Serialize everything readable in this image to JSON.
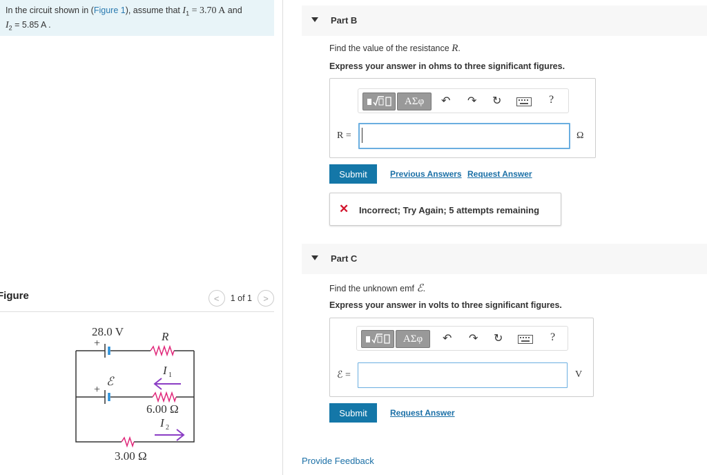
{
  "problem": {
    "text_a": "In the circuit shown in (",
    "link": "Figure 1",
    "text_b": "), assume that ",
    "i1_var": "I",
    "i1_sub": "1",
    "i1_val": " = 3.70 A",
    "and": " and",
    "i2_var": "I",
    "i2_sub": "2",
    "i2_val": " = 5.85 A",
    "end": " ."
  },
  "figure": {
    "title": "Figure",
    "pager_text": "1 of 1",
    "prev": "<",
    "next": ">"
  },
  "circuit": {
    "emf1_label": "28.0 V",
    "r_label": "R",
    "i1_label": "I",
    "i1_sub": "1",
    "emf_label": "ℰ",
    "r6_label": "6.00 Ω",
    "i2_label": "I",
    "i2_sub": "2",
    "r3_label": "3.00 Ω",
    "plus1": "+",
    "plus2": "+"
  },
  "toolbar": {
    "greek": "ΑΣφ",
    "help": "?"
  },
  "part_b": {
    "title": "Part B",
    "question_a": "Find the value of the resistance ",
    "question_var": "R",
    "question_b": ".",
    "instruction": "Express your answer in ohms to three significant figures.",
    "var_label": "R =",
    "value": "",
    "unit": "Ω",
    "submit": "Submit",
    "previous_answers": "Previous Answers",
    "request_answer": "Request Answer",
    "feedback": "Incorrect; Try Again; 5 attempts remaining"
  },
  "part_c": {
    "title": "Part C",
    "question_a": "Find the unknown emf ",
    "question_var": "ℰ",
    "question_b": ".",
    "instruction": "Express your answer in volts to three significant figures.",
    "var_label": "ℰ =",
    "value": "",
    "unit": "V",
    "submit": "Submit",
    "request_answer": "Request Answer"
  },
  "provide_feedback": "Provide Feedback",
  "colors": {
    "accent": "#1477a8",
    "link": "#1a6fa6",
    "resistor": "#e0287a",
    "arrow": "#8a3cc4",
    "battery": "#2a8fd8",
    "error": "#d2142c"
  }
}
